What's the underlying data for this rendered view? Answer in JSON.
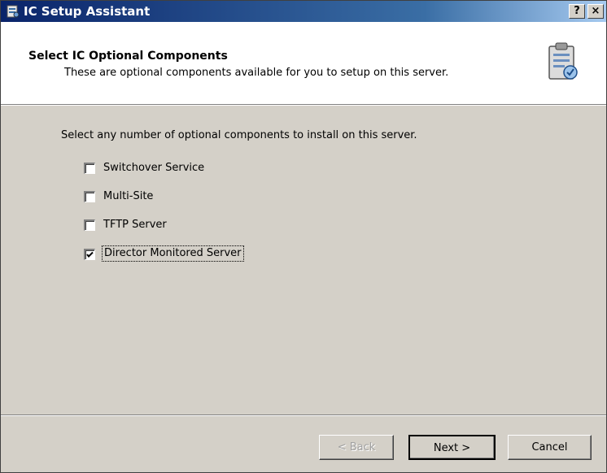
{
  "window": {
    "title": "IC Setup Assistant",
    "help_button": "?",
    "close_button": "×"
  },
  "header": {
    "title": "Select IC Optional Components",
    "subtitle": "These are optional components available for you to setup on this server."
  },
  "main": {
    "prompt": "Select any number of optional components to install on this server.",
    "options": [
      {
        "label": "Switchover Service",
        "checked": false
      },
      {
        "label": "Multi-Site",
        "checked": false
      },
      {
        "label": "TFTP Server",
        "checked": false
      },
      {
        "label": "Director Monitored Server",
        "checked": true
      }
    ]
  },
  "footer": {
    "back_label": "< Back",
    "next_label": "Next >",
    "cancel_label": "Cancel"
  }
}
